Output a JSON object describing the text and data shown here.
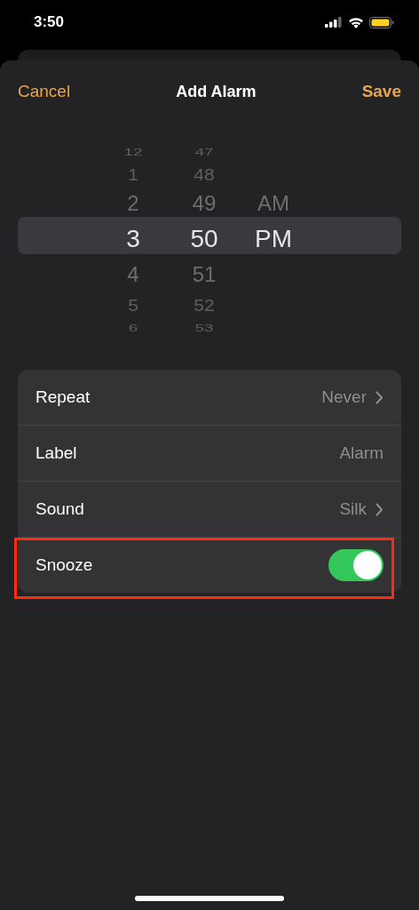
{
  "status_bar": {
    "time": "3:50"
  },
  "nav": {
    "cancel": "Cancel",
    "title": "Add Alarm",
    "save": "Save"
  },
  "picker": {
    "columns": [
      {
        "items": [
          {
            "label": "12",
            "selected": false
          },
          {
            "label": "1",
            "selected": false
          },
          {
            "label": "2",
            "selected": false
          },
          {
            "label": "3",
            "selected": true
          },
          {
            "label": "4",
            "selected": false
          },
          {
            "label": "5",
            "selected": false
          },
          {
            "label": "6",
            "selected": false
          }
        ]
      },
      {
        "items": [
          {
            "label": "47",
            "selected": false
          },
          {
            "label": "48",
            "selected": false
          },
          {
            "label": "49",
            "selected": false
          },
          {
            "label": "50",
            "selected": true
          },
          {
            "label": "51",
            "selected": false
          },
          {
            "label": "52",
            "selected": false
          },
          {
            "label": "53",
            "selected": false
          }
        ]
      },
      {
        "items": [
          {
            "label": "AM",
            "selected": false
          },
          {
            "label": "PM",
            "selected": true
          }
        ]
      }
    ]
  },
  "settings": [
    {
      "kind": "link",
      "label": "Repeat",
      "value": "Never",
      "highlighted": false
    },
    {
      "kind": "text",
      "label": "Label",
      "value": "Alarm",
      "highlighted": false
    },
    {
      "kind": "link",
      "label": "Sound",
      "value": "Silk",
      "highlighted": false
    },
    {
      "kind": "toggle",
      "label": "Snooze",
      "on": true,
      "highlighted": true
    }
  ]
}
